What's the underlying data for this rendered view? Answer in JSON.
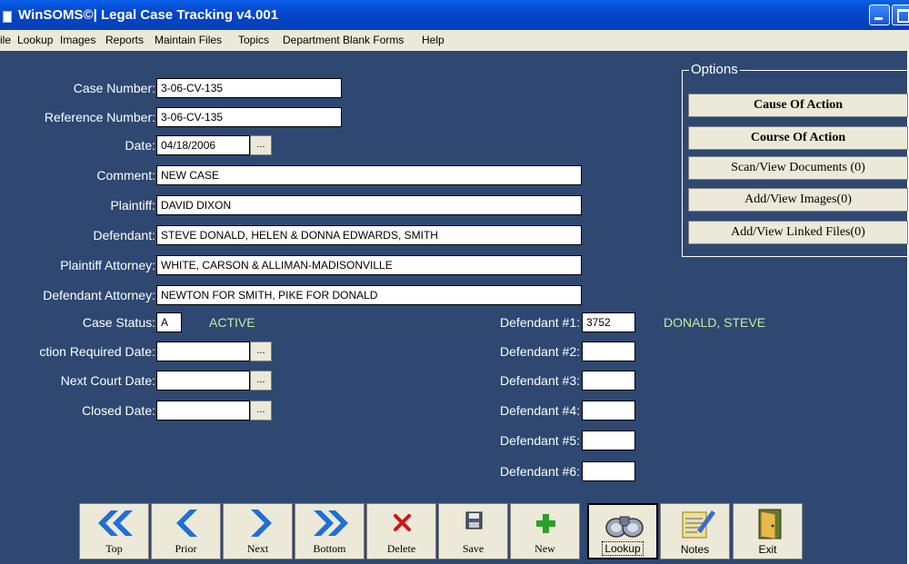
{
  "window": {
    "title": "WinSOMS©| Legal Case Tracking v4.001"
  },
  "menu": [
    "ile",
    "Lookup",
    "Images",
    "Reports",
    "Maintain Files",
    "Topics",
    "Department Blank Forms",
    "Help"
  ],
  "form": {
    "case_number": {
      "label": "Case Number:",
      "value": "3-06-CV-135"
    },
    "reference_number": {
      "label": "Reference Number:",
      "value": "3-06-CV-135"
    },
    "date": {
      "label": "Date:",
      "value": "04/18/2006"
    },
    "comment": {
      "label": "Comment:",
      "value": "NEW CASE"
    },
    "plaintiff": {
      "label": "Plaintiff:",
      "value": "DAVID DIXON"
    },
    "defendant": {
      "label": "Defendant:",
      "value": "STEVE DONALD, HELEN & DONNA EDWARDS, SMITH"
    },
    "plaintiff_attorney": {
      "label": "Plaintiff Attorney:",
      "value": "WHITE, CARSON & ALLIMAN-MADISONVILLE"
    },
    "defendant_attorney": {
      "label": "Defendant Attorney:",
      "value": "NEWTON FOR SMITH, PIKE FOR DONALD"
    },
    "case_status": {
      "label": "Case Status:",
      "value": "A",
      "text": "ACTIVE"
    },
    "action_required_date": {
      "label": "ction Required Date:",
      "value": ""
    },
    "next_court_date": {
      "label": "Next Court Date:",
      "value": ""
    },
    "closed_date": {
      "label": "Closed Date:",
      "value": ""
    },
    "ellipsis": "..."
  },
  "defendants": [
    {
      "label": "Defendant #1:",
      "value": "3752",
      "name": "DONALD, STEVE"
    },
    {
      "label": "Defendant #2:",
      "value": ""
    },
    {
      "label": "Defendant #3:",
      "value": ""
    },
    {
      "label": "Defendant #4:",
      "value": ""
    },
    {
      "label": "Defendant #5:",
      "value": ""
    },
    {
      "label": "Defendant #6:",
      "value": ""
    }
  ],
  "options": {
    "title": "Options",
    "buttons": [
      "Cause Of Action",
      "Course Of Action",
      "Scan/View Documents (0)",
      "Add/View Images(0)",
      "Add/View Linked Files(0)"
    ]
  },
  "toolbar": [
    "Top",
    "Prior",
    "Next",
    "Bottom",
    "Delete",
    "Save",
    "New",
    "Lookup",
    "Notes",
    "Exit"
  ],
  "colors": {
    "background": "#2e4872",
    "status_text": "#cce8a0",
    "titlebar": "#0446c9"
  },
  "icons": [
    "double-chevron-left-icon",
    "chevron-left-icon",
    "chevron-right-icon",
    "double-chevron-right-icon",
    "delete-x-icon",
    "floppy-disk-icon",
    "plus-icon",
    "binoculars-icon",
    "notepad-pencil-icon",
    "exit-door-icon"
  ]
}
